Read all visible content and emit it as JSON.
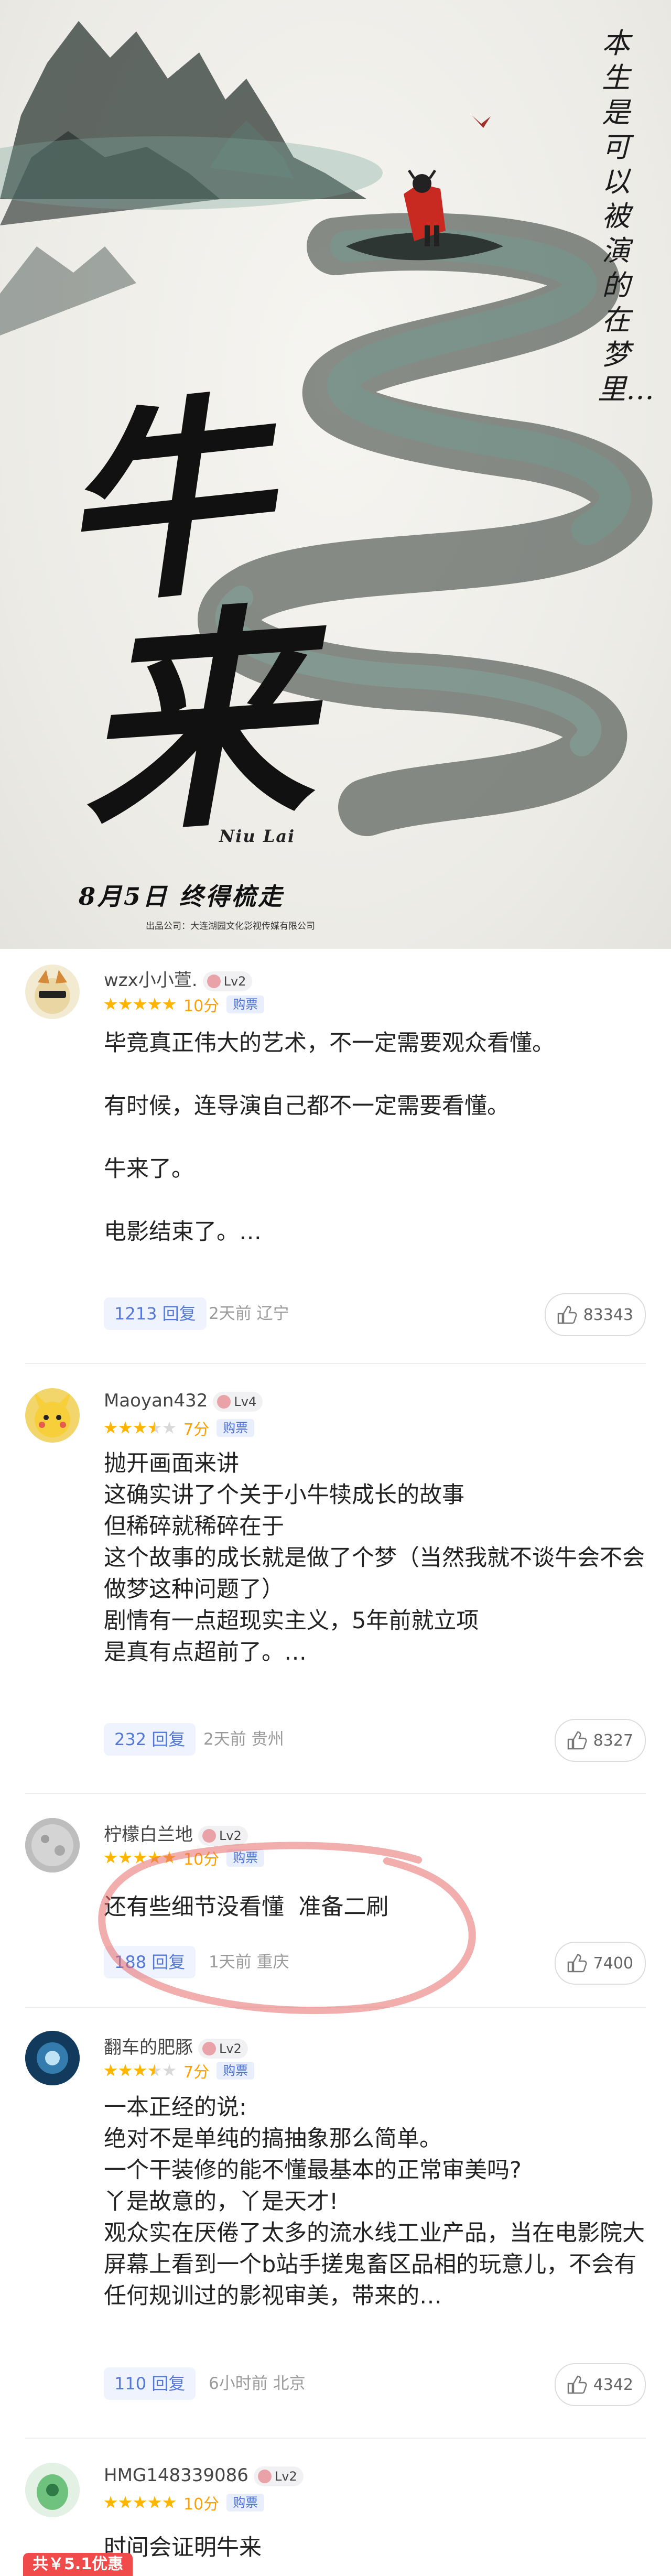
{
  "poster": {
    "vertical_text": "本生是可以被演的在梦里…",
    "title_1": "牛",
    "title_2": "来",
    "pinyin": "Niu Lai",
    "date_line": "8月5日 终得梳走",
    "credit": "出品公司：大连湖园文化影视传媒有限公司"
  },
  "comments": [
    {
      "user": "wzx小小萱.",
      "level": "Lv2",
      "stars": 5,
      "score": "10分",
      "tag": "购票",
      "text": "毕竟真正伟大的艺术，不一定需要观众看懂。\n\n有时候，连导演自己都不一定需要看懂。\n\n牛来了。\n\n电影结束了。…",
      "replies": "1213 回复",
      "time_place": "2天前 辽宁",
      "likes": "83343"
    },
    {
      "user": "Maoyan432",
      "level": "Lv4",
      "stars": 3.5,
      "score": "7分",
      "tag": "购票",
      "text": "抛开画面来讲\n这确实讲了个关于小牛犊成长的故事\n但稀碎就稀碎在于\n这个故事的成长就是做了个梦（当然我就不谈牛会不会做梦这种问题了）\n剧情有一点超现实主义，5年前就立项\n是真有点超前了。…",
      "replies": "232 回复",
      "time_place": "2天前 贵州",
      "likes": "8327"
    },
    {
      "user": "柠檬白兰地",
      "level": "Lv2",
      "stars": 5,
      "score": "10分",
      "tag": "购票",
      "text": "还有些细节没看懂  准备二刷",
      "replies": "188 回复",
      "time_place": "1天前 重庆",
      "likes": "7400"
    },
    {
      "user": "翻车的肥豚",
      "level": "Lv2",
      "stars": 3.5,
      "score": "7分",
      "tag": "购票",
      "text": "一本正经的说:\n绝对不是单纯的搞抽象那么简单。\n一个干装修的能不懂最基本的正常审美吗?\n丫是故意的，丫是天才!\n观众实在厌倦了太多的流水线工业产品，当在电影院大屏幕上看到一个b站手搓鬼畜区品相的玩意儿，不会有任何规训过的影视审美，带来的…",
      "replies": "110 回复",
      "time_place": "6小时前 北京",
      "likes": "4342"
    },
    {
      "user": "HMG148339086",
      "level": "Lv2",
      "stars": 5,
      "score": "10分",
      "tag": "购票",
      "text": "时间会证明牛来",
      "replies": "",
      "time_place": "",
      "likes": ""
    }
  ],
  "promo": "共￥5.1优惠",
  "colors": {
    "star": "#ffb400",
    "score": "#ff9f00",
    "reply": "#5478d8",
    "promo": "#f04a4a",
    "annotation": "#e86a6a"
  }
}
